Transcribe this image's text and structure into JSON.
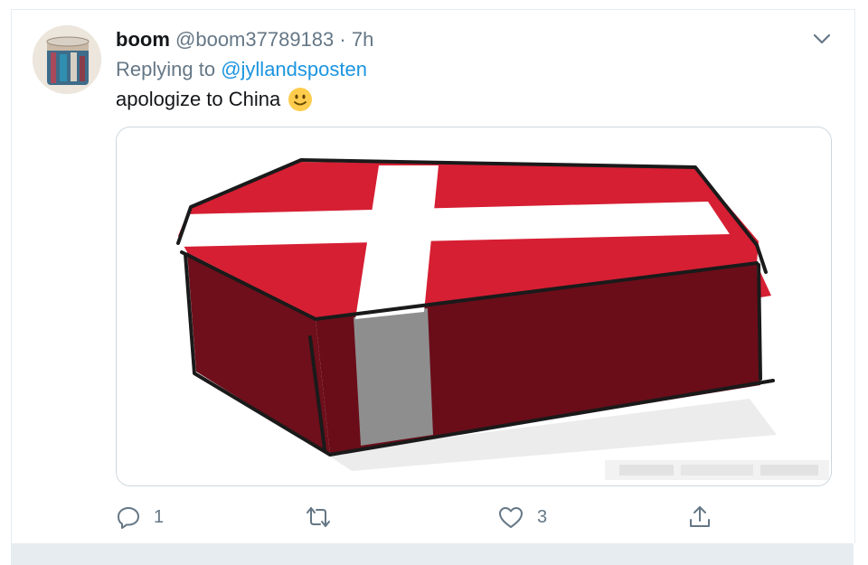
{
  "tweet": {
    "display_name": "boom",
    "handle": "@boom37789183",
    "separator": "·",
    "time": "7h",
    "replying_prefix": "Replying to",
    "replying_to": "@jyllandsposten",
    "text": "apologize to China",
    "emoji": "slightly-smiling-face"
  },
  "actions": {
    "reply_count": "1",
    "retweet_count": "",
    "like_count": "3"
  },
  "colors": {
    "link": "#1b95e0",
    "secondary_text": "#657786",
    "primary_text": "#14171a",
    "flag_red": "#d61f33",
    "coffin_side": "#6e0f1b"
  }
}
